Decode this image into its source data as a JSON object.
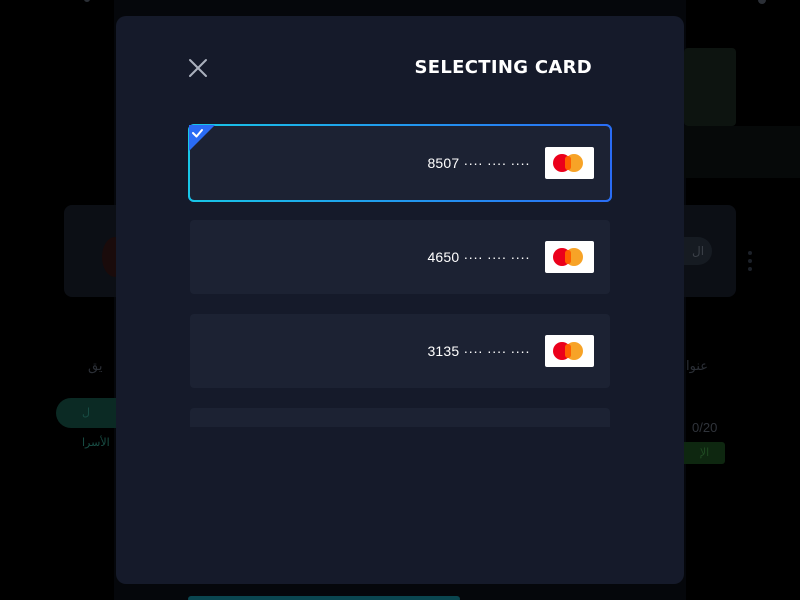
{
  "background_page": {
    "right_pill_text": "ال",
    "left_text": "يق",
    "right_text": "عنوا",
    "left_button_text": "ل الأسرا",
    "count_text": "0/20",
    "green_badge_text": "الإ"
  },
  "modal": {
    "title": "SELECTING CARD",
    "close_icon": "close-icon",
    "cards": [
      {
        "number": "8507 ···· ···· ····",
        "brand": "mastercard",
        "selected": true
      },
      {
        "number": "4650 ···· ···· ····",
        "brand": "mastercard",
        "selected": false
      },
      {
        "number": "3135 ···· ···· ····",
        "brand": "mastercard",
        "selected": false
      },
      {
        "number": "",
        "brand": "",
        "selected": false
      }
    ]
  },
  "colors": {
    "modal_bg": "#151a2a",
    "card_bg": "#1c2233",
    "selected_border_start": "#18c6e6",
    "selected_border_end": "#2a6cf5",
    "check_badge": "#2a6cf5"
  }
}
